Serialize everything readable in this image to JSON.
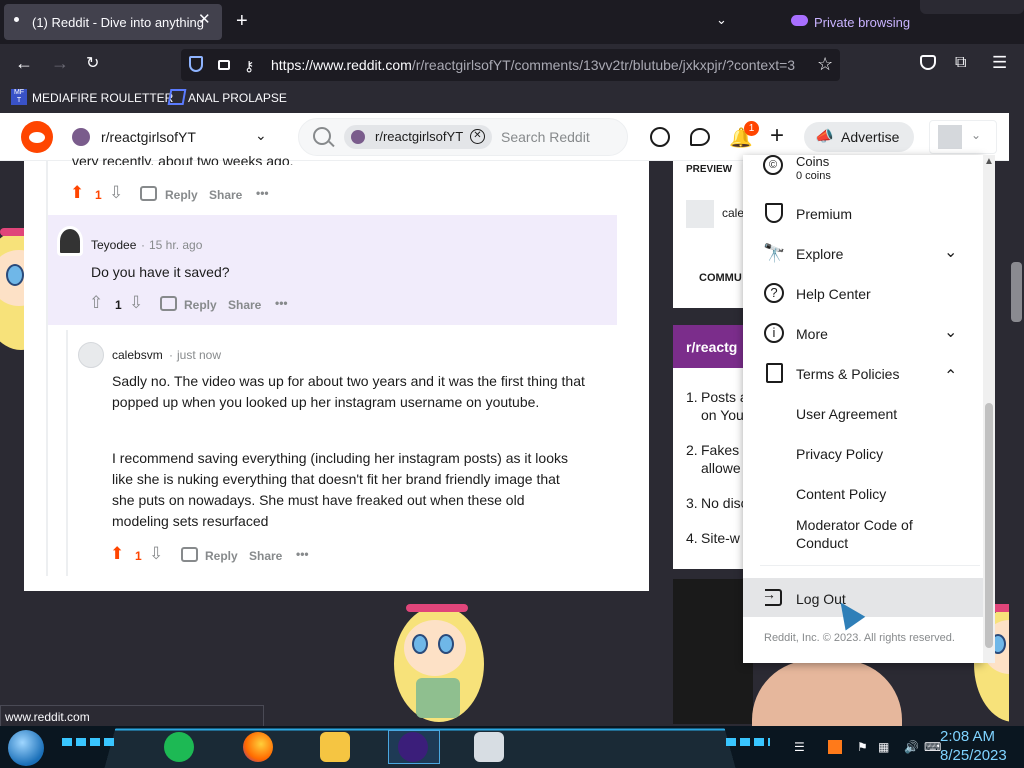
{
  "browser": {
    "tab_title": "(1) Reddit - Dive into anything",
    "tab_close": "✕",
    "new_tab": "+",
    "tab_list": "⌄",
    "private_browsing": "Private browsing",
    "url_host": "https://www.reddit.com",
    "url_path": "/r/reactgirlsofYT/comments/13vv2tr/blutube/jxkxpjr/?context=3",
    "bookmarks": [
      {
        "icon_text": "MF T",
        "label": "MEDIAFIRE ROULETTER"
      },
      {
        "icon_text": "",
        "label": "ANAL PROLAPSE"
      }
    ],
    "status_url": "www.reddit.com"
  },
  "header": {
    "subreddit": "r/reactgirlsofYT",
    "search_chip": "r/reactgirlsofYT",
    "search_placeholder": "Search Reddit",
    "notification_count": "1",
    "advertise_label": "Advertise"
  },
  "comments": {
    "top_text": "very recently, about two weeks ago.",
    "top_votes": "1",
    "teyodee": {
      "author": "Teyodee",
      "time": "15 hr. ago",
      "text": "Do you have it saved?",
      "votes": "1"
    },
    "calebsvm": {
      "author": "calebsvm",
      "time": "just now",
      "paragraph1": "Sadly no. The video was up for about two years and it was the first thing that popped up when you looked up her instagram username on youtube.",
      "paragraph2": "I recommend saving everything (including her instagram posts) as it looks like she is nuking everything that doesn't fit her brand friendly image that she puts on nowadays. She must have freaked out when these old modeling sets resurfaced",
      "votes": "1"
    },
    "actions": {
      "reply": "Reply",
      "share": "Share",
      "more": "•••"
    }
  },
  "sidebar": {
    "preview_label": "PREVIEW",
    "preview_user": "cale",
    "community_label": "COMMU",
    "rules_title": "r/reactg",
    "rules": [
      {
        "num": "1.",
        "line1": "Posts a",
        "line2": "on You"
      },
      {
        "num": "2.",
        "line1": "Fakes a",
        "line2": "allowe"
      },
      {
        "num": "3.",
        "line1": "No disc",
        "line2": ""
      },
      {
        "num": "4.",
        "line1": "Site-w",
        "line2": ""
      }
    ]
  },
  "dropdown": {
    "coins_label": "Coins",
    "coins_value": "0 coins",
    "items": {
      "premium": "Premium",
      "explore": "Explore",
      "help_center": "Help Center",
      "more": "More",
      "terms": "Terms & Policies",
      "user_agreement": "User Agreement",
      "privacy_policy": "Privacy Policy",
      "content_policy": "Content Policy",
      "moderator_code_1": "Moderator Code of",
      "moderator_code_2": "Conduct",
      "log_out": "Log Out"
    },
    "copyright": "Reddit, Inc. © 2023. All rights reserved."
  },
  "taskbar": {
    "time": "2:08 AM",
    "date": "8/25/2023"
  },
  "icons": {
    "reddit_logo": "reddit-logo",
    "accent": "#ff4500",
    "private_color": "#a86fff"
  }
}
